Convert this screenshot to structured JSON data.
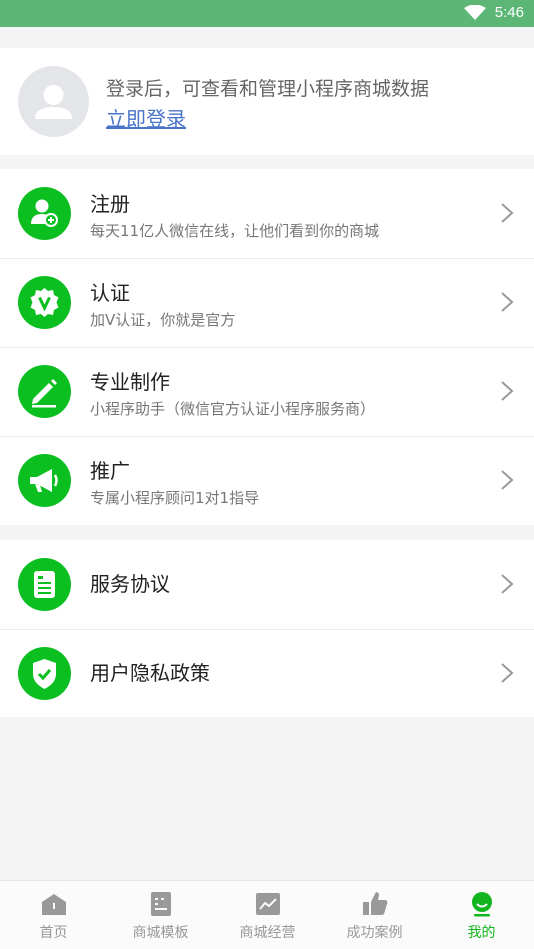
{
  "status": {
    "time": "5:46"
  },
  "profile": {
    "tip": "登录后，可查看和管理小程序商城数据",
    "login_label": "立即登录"
  },
  "menu": [
    {
      "icon": "add-user-icon",
      "title": "注册",
      "sub": "每天11亿人微信在线，让他们看到你的商城"
    },
    {
      "icon": "verified-v-icon",
      "title": "认证",
      "sub": "加V认证，你就是官方"
    },
    {
      "icon": "pen-icon",
      "title": "专业制作",
      "sub": "小程序助手（微信官方认证小程序服务商）"
    },
    {
      "icon": "megaphone-icon",
      "title": "推广",
      "sub": "专属小程序顾问1对1指导"
    }
  ],
  "menu2": [
    {
      "icon": "document-icon",
      "title": "服务协议"
    },
    {
      "icon": "shield-check-icon",
      "title": "用户隐私政策"
    }
  ],
  "tabs": [
    {
      "icon": "home-icon",
      "label": "首页"
    },
    {
      "icon": "template-icon",
      "label": "商城模板"
    },
    {
      "icon": "chart-icon",
      "label": "商城经营"
    },
    {
      "icon": "thumbs-up-icon",
      "label": "成功案例"
    },
    {
      "icon": "profile-icon",
      "label": "我的"
    }
  ],
  "active_tab": "我的",
  "colors": {
    "accent": "#0cbf20",
    "status_bar": "#5cb777",
    "link": "#4a74c9",
    "active_tab": "#12b51e",
    "inactive_tab": "#999999"
  }
}
